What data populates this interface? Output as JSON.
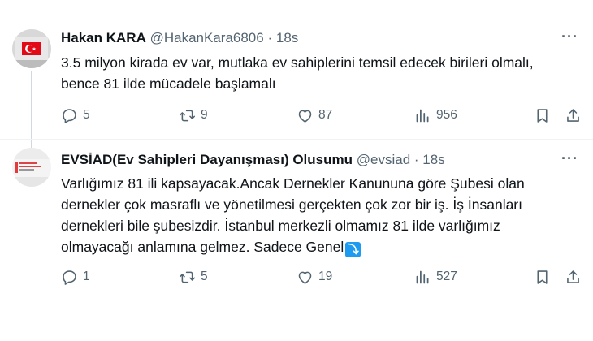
{
  "tweets": [
    {
      "name": "Hakan KARA",
      "handle": "@HakanKara6806",
      "separator": "·",
      "time": "18s",
      "text": "3.5 milyon kirada ev var, mutlaka ev sahiplerini temsil edecek birileri olmalı,\nbence  81 ilde mücadele başlamalı",
      "replies": "5",
      "retweets": "9",
      "likes": "87",
      "views": "956",
      "more_label": "···"
    },
    {
      "name": "EVSİAD(Ev Sahipleri Dayanışması) Olusumu",
      "handle": "@evsiad",
      "separator": "·",
      "time": "18s",
      "text": "Varlığımız 81 ili kapsayacak.Ancak Dernekler Kanununa göre Şubesi olan\ndernekler çok masraflı ve yönetilmesi gerçekten çok zor bir iş. İş İnsanları\ndernekleri bile şubesizdir. İstanbul merkezli olmamız  81 ilde varlığımız\nolmayacağı anlamına gelmez. Sadece Genel",
      "show_more_glyph": "⤵",
      "replies": "1",
      "retweets": "5",
      "likes": "19",
      "views": "527",
      "more_label": "···"
    }
  ],
  "icons": {
    "reply": "reply-icon",
    "retweet": "retweet-icon",
    "like": "heart-icon",
    "views": "views-bar-chart-icon",
    "bookmark": "bookmark-icon",
    "share": "share-icon"
  },
  "colors": {
    "text": "#0f1419",
    "secondary": "#536471",
    "link_blue": "#1d9bf0",
    "divider": "#eff3f4"
  }
}
